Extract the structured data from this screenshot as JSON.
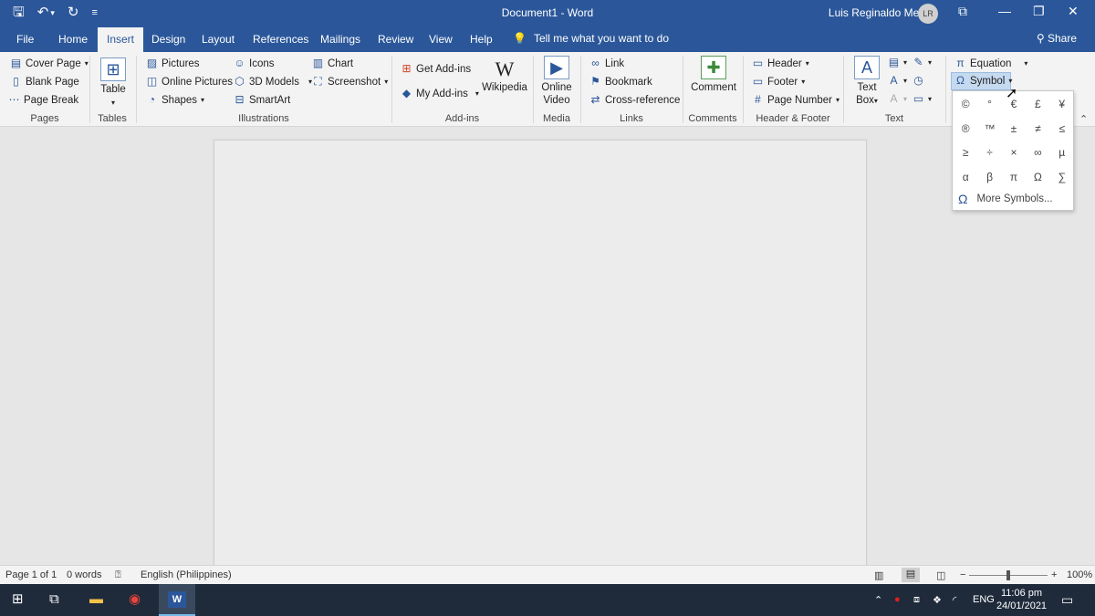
{
  "title_bar": {
    "document_title": "Document1 - Word",
    "user_name": "Luis Reginaldo Medilo",
    "user_initials": "LR",
    "qat": {
      "save": "🖫",
      "undo": "↶",
      "undo_arrow": "▾",
      "redo": "↻",
      "customize": "≡"
    },
    "controls": {
      "ribbon_display": "⧉",
      "minimize": "—",
      "restore": "❐",
      "close": "✕"
    }
  },
  "tabs": [
    "File",
    "Home",
    "Insert",
    "Design",
    "Layout",
    "References",
    "Mailings",
    "Review",
    "View",
    "Help"
  ],
  "tell_me": "Tell me what you want to do",
  "share": "Share",
  "ribbon": {
    "pages": {
      "label": "Pages",
      "cover_page": "Cover Page",
      "blank_page": "Blank Page",
      "page_break": "Page Break"
    },
    "tables": {
      "label": "Tables",
      "table": "Table"
    },
    "illustrations": {
      "label": "Illustrations",
      "pictures": "Pictures",
      "online_pictures": "Online Pictures",
      "shapes": "Shapes",
      "icons": "Icons",
      "models_3d": "3D Models",
      "smartart": "SmartArt",
      "chart": "Chart",
      "screenshot": "Screenshot"
    },
    "addins": {
      "label": "Add-ins",
      "get_addins": "Get Add-ins",
      "my_addins": "My Add-ins",
      "wikipedia": "Wikipedia"
    },
    "media": {
      "label": "Media",
      "online_video_1": "Online",
      "online_video_2": "Video"
    },
    "links": {
      "label": "Links",
      "link": "Link",
      "bookmark": "Bookmark",
      "cross_reference": "Cross-reference"
    },
    "comments": {
      "label": "Comments",
      "comment": "Comment"
    },
    "header_footer": {
      "label": "Header & Footer",
      "header": "Header",
      "footer": "Footer",
      "page_number": "Page Number"
    },
    "text": {
      "label": "Text",
      "text_box_1": "Text",
      "text_box_2": "Box"
    },
    "symbols": {
      "equation": "Equation",
      "symbol": "Symbol"
    }
  },
  "symbol_panel": {
    "symbols": [
      "©",
      "°",
      "€",
      "£",
      "¥",
      "®",
      "™",
      "±",
      "≠",
      "≤",
      "≥",
      "÷",
      "×",
      "∞",
      "µ",
      "α",
      "β",
      "π",
      "Ω",
      "∑"
    ],
    "more_symbols": "More Symbols..."
  },
  "status_bar": {
    "page": "Page 1 of 1",
    "words": "0 words",
    "language": "English (Philippines)",
    "zoom": "100%",
    "zoom_minus": "−",
    "zoom_plus": "+"
  },
  "taskbar": {
    "language": "ENG",
    "time": "11:06 pm",
    "date": "24/01/2021"
  }
}
